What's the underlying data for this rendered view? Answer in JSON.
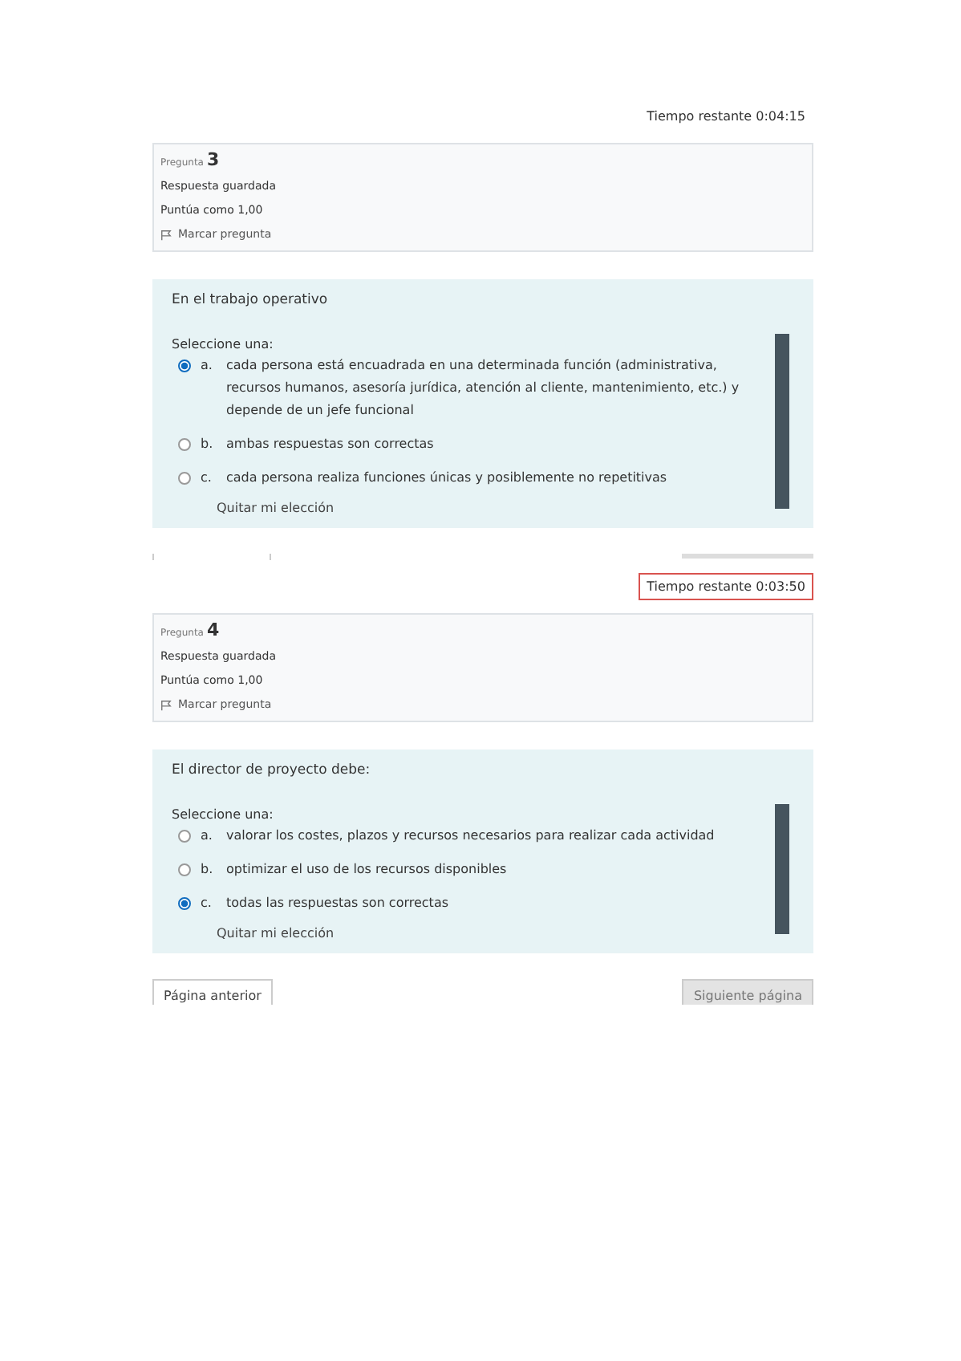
{
  "questions": [
    {
      "timer": {
        "text": "Tiempo restante 0:04:15",
        "warning": false
      },
      "cut_nav_above": false,
      "label": "Pregunta",
      "number": "3",
      "state": "Respuesta guardada",
      "grade": "Puntúa como 1,00",
      "flag": "Marcar pregunta",
      "text": "En el trabajo operativo",
      "prompt": "Seleccione una:",
      "options": [
        {
          "letter": "a.",
          "text": "cada persona está encuadrada en una determinada función (administrativa, recursos humanos, asesoría jurídica, atención al cliente, mantenimiento, etc.) y depende de un jefe funcional",
          "selected": true
        },
        {
          "letter": "b.",
          "text": "ambas respuestas son correctas",
          "selected": false
        },
        {
          "letter": "c.",
          "text": "cada persona realiza funciones únicas y posiblemente no repetitivas",
          "selected": false
        }
      ],
      "clear": "Quitar mi elección"
    },
    {
      "timer": {
        "text": "Tiempo restante 0:03:50",
        "warning": true
      },
      "cut_nav_above": true,
      "label": "Pregunta",
      "number": "4",
      "state": "Respuesta guardada",
      "grade": "Puntúa como 1,00",
      "flag": "Marcar pregunta",
      "text": "El director de proyecto debe:",
      "prompt": "Seleccione una:",
      "options": [
        {
          "letter": "a.",
          "text": "valorar los costes, plazos y recursos necesarios para realizar cada actividad",
          "selected": false
        },
        {
          "letter": "b.",
          "text": "optimizar el uso de los recursos disponibles",
          "selected": false
        },
        {
          "letter": "c.",
          "text": "todas las respuestas son correctas",
          "selected": true
        }
      ],
      "clear": "Quitar mi elección"
    }
  ],
  "nav": {
    "previous": "Página anterior",
    "next": "Siguiente página"
  }
}
